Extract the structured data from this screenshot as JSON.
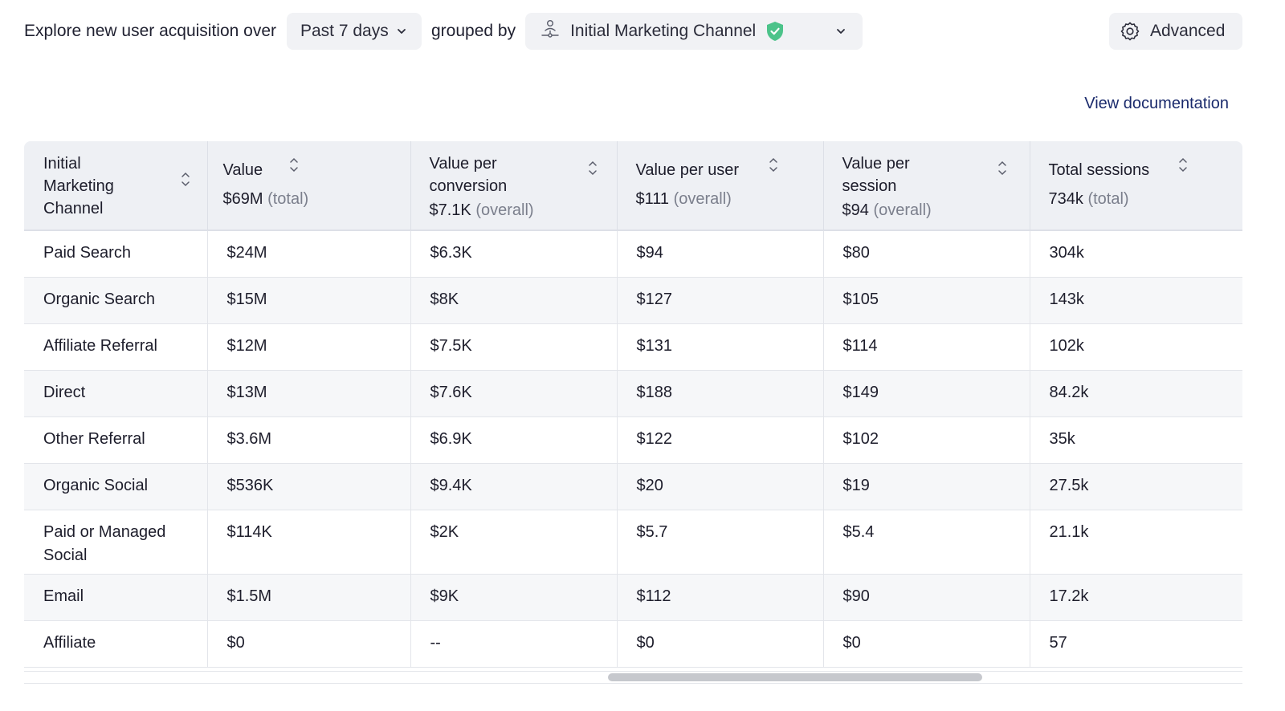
{
  "toolbar": {
    "explore_label": "Explore new user acquisition over",
    "period_value": "Past 7 days",
    "grouped_label": "grouped by",
    "group_value": "Initial Marketing Channel",
    "advanced_label": "Advanced"
  },
  "links": {
    "documentation": "View documentation"
  },
  "colors": {
    "shield": "#4cc38a",
    "link": "#1a2a6c",
    "header_bg": "#eef0f4",
    "row_alt": "#f6f7f9"
  },
  "table": {
    "columns": [
      {
        "title": "Initial Marketing Channel",
        "summary": "",
        "summary_note": ""
      },
      {
        "title": "Value",
        "summary": "$69M",
        "summary_note": "(total)"
      },
      {
        "title": "Value per conversion",
        "summary": "$7.1K",
        "summary_note": "(overall)"
      },
      {
        "title": "Value per user",
        "summary": "$111",
        "summary_note": "(overall)"
      },
      {
        "title": "Value per session",
        "summary": "$94",
        "summary_note": "(overall)"
      },
      {
        "title": "Total sessions",
        "summary": "734k",
        "summary_note": "(total)"
      }
    ],
    "rows": [
      {
        "channel": "Paid Search",
        "value": "$24M",
        "per_conversion": "$6.3K",
        "per_user": "$94",
        "per_session": "$80",
        "sessions": "304k"
      },
      {
        "channel": "Organic Search",
        "value": "$15M",
        "per_conversion": "$8K",
        "per_user": "$127",
        "per_session": "$105",
        "sessions": "143k"
      },
      {
        "channel": "Affiliate Referral",
        "value": "$12M",
        "per_conversion": "$7.5K",
        "per_user": "$131",
        "per_session": "$114",
        "sessions": "102k"
      },
      {
        "channel": "Direct",
        "value": "$13M",
        "per_conversion": "$7.6K",
        "per_user": "$188",
        "per_session": "$149",
        "sessions": "84.2k"
      },
      {
        "channel": "Other Referral",
        "value": "$3.6M",
        "per_conversion": "$6.9K",
        "per_user": "$122",
        "per_session": "$102",
        "sessions": "35k"
      },
      {
        "channel": "Organic Social",
        "value": "$536K",
        "per_conversion": "$9.4K",
        "per_user": "$20",
        "per_session": "$19",
        "sessions": "27.5k"
      },
      {
        "channel": "Paid or Managed Social",
        "value": "$114K",
        "per_conversion": "$2K",
        "per_user": "$5.7",
        "per_session": "$5.4",
        "sessions": "21.1k"
      },
      {
        "channel": "Email",
        "value": "$1.5M",
        "per_conversion": "$9K",
        "per_user": "$112",
        "per_session": "$90",
        "sessions": "17.2k"
      },
      {
        "channel": "Affiliate",
        "value": "$0",
        "per_conversion": "--",
        "per_user": "$0",
        "per_session": "$0",
        "sessions": "57"
      }
    ]
  }
}
